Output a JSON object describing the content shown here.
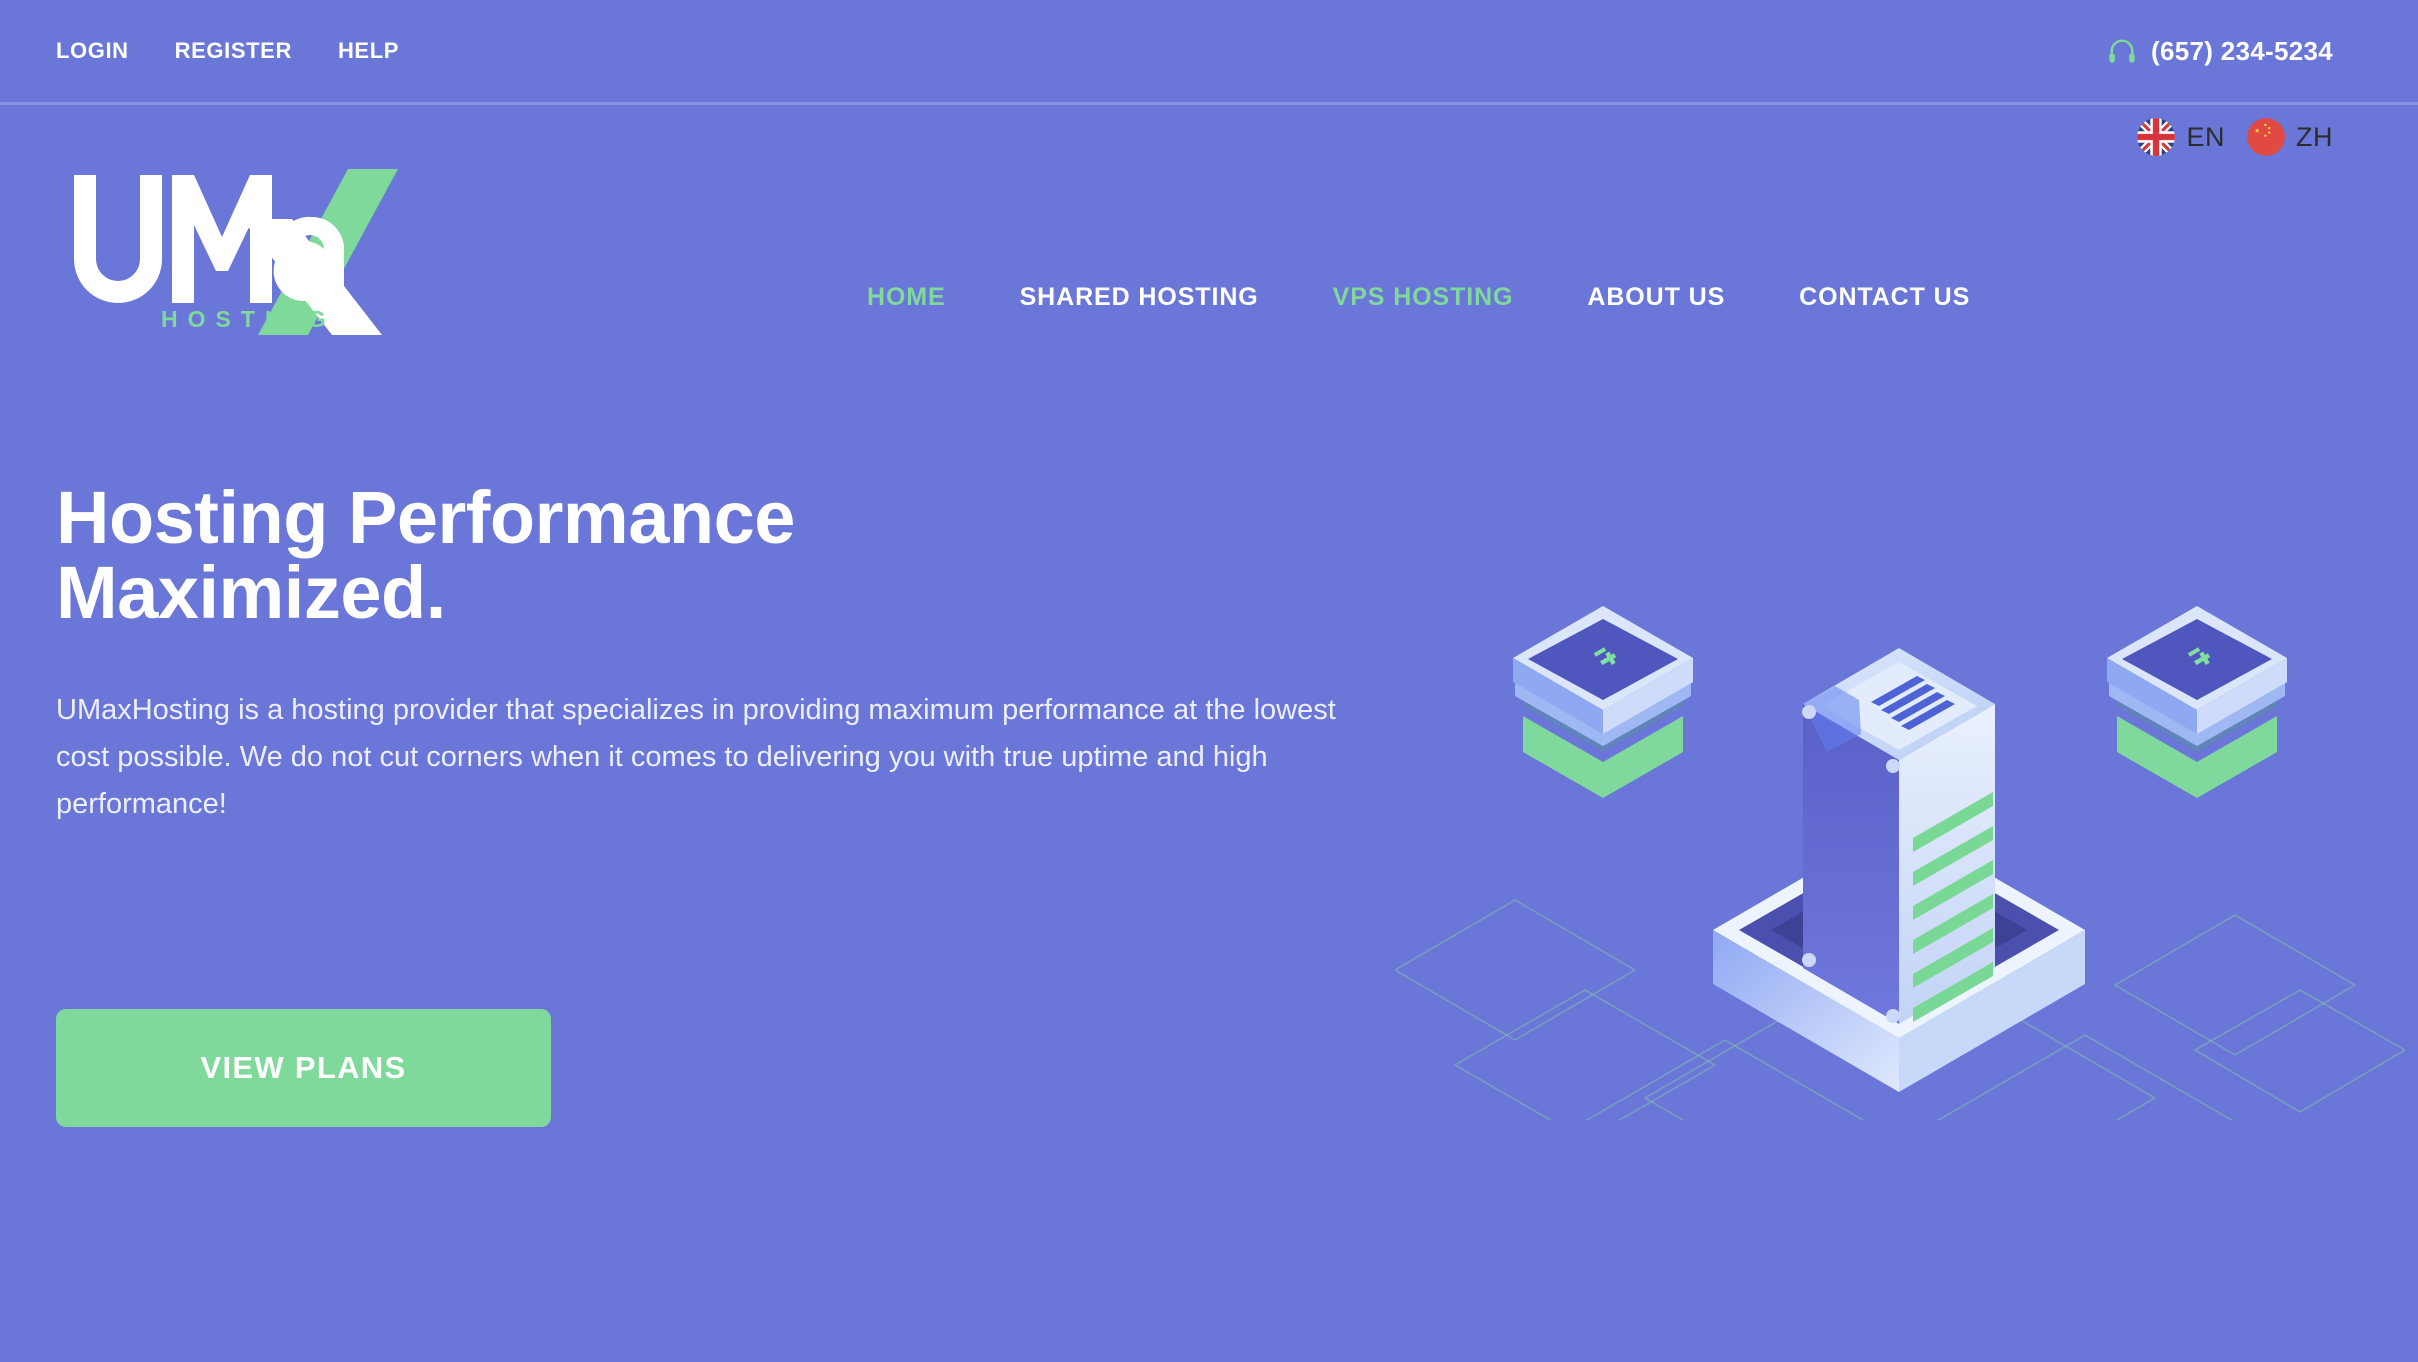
{
  "topbar": {
    "links": [
      {
        "label": "LOGIN",
        "name": "login"
      },
      {
        "label": "REGISTER",
        "name": "register"
      },
      {
        "label": "HELP",
        "name": "help"
      }
    ],
    "phone": "(657) 234-5234",
    "phone_icon": "headset-icon"
  },
  "language": {
    "options": [
      {
        "code": "EN",
        "flag": "uk-flag-icon"
      },
      {
        "code": "ZH",
        "flag": "china-flag-icon"
      }
    ]
  },
  "logo": {
    "brand": "UMaX",
    "tagline": "HOSTING"
  },
  "nav": {
    "items": [
      {
        "label": "HOME",
        "active": true
      },
      {
        "label": "SHARED HOSTING",
        "active": false
      },
      {
        "label": "VPS HOSTING",
        "active": true
      },
      {
        "label": "ABOUT US",
        "active": false
      },
      {
        "label": "CONTACT US",
        "active": false
      }
    ]
  },
  "hero": {
    "title_line1": "Hosting Performance",
    "title_line2": "Maximized.",
    "description": "UMaxHosting is a hosting provider that specializes in providing maximum performance at the lowest cost possible. We do not cut corners when it comes to delivering you with true uptime and high performance!",
    "cta_label": "VIEW PLANS",
    "illustration": "isometric-server-rack-illustration"
  },
  "colors": {
    "background": "#6a76d8",
    "accent_green": "#7fd99b",
    "text_white": "#ffffff",
    "lang_text": "#2c2c2c",
    "flag_red": "#e04a42",
    "flag_navy": "#2a4480",
    "divider": "#8b94e2"
  }
}
